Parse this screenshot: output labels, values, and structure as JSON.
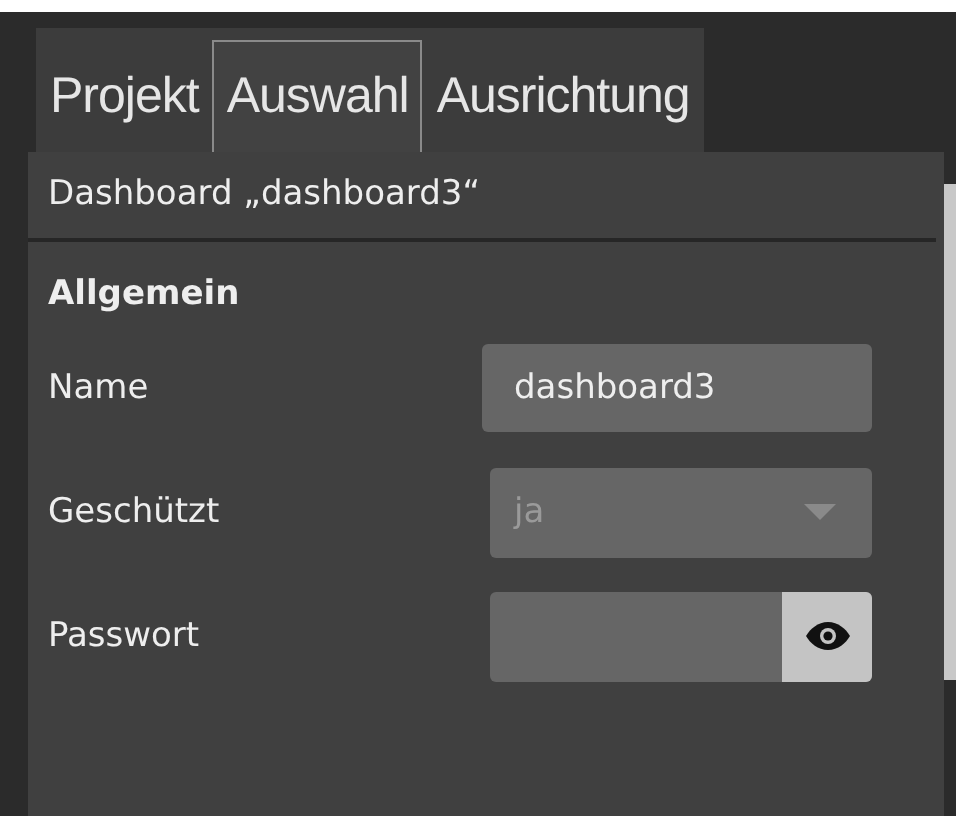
{
  "tabs": [
    {
      "label": "Projekt",
      "selected": false
    },
    {
      "label": "Auswahl",
      "selected": true
    },
    {
      "label": "Ausrichtung",
      "selected": false
    }
  ],
  "panel": {
    "title": "Dashboard „dashboard3“",
    "section": "Allgemein",
    "fields": [
      {
        "kind": "text",
        "label": "Name",
        "value": "dashboard3"
      },
      {
        "kind": "select",
        "label": "Geschützt",
        "value": "ja",
        "disabled": true
      },
      {
        "kind": "password",
        "label": "Passwort"
      }
    ]
  }
}
